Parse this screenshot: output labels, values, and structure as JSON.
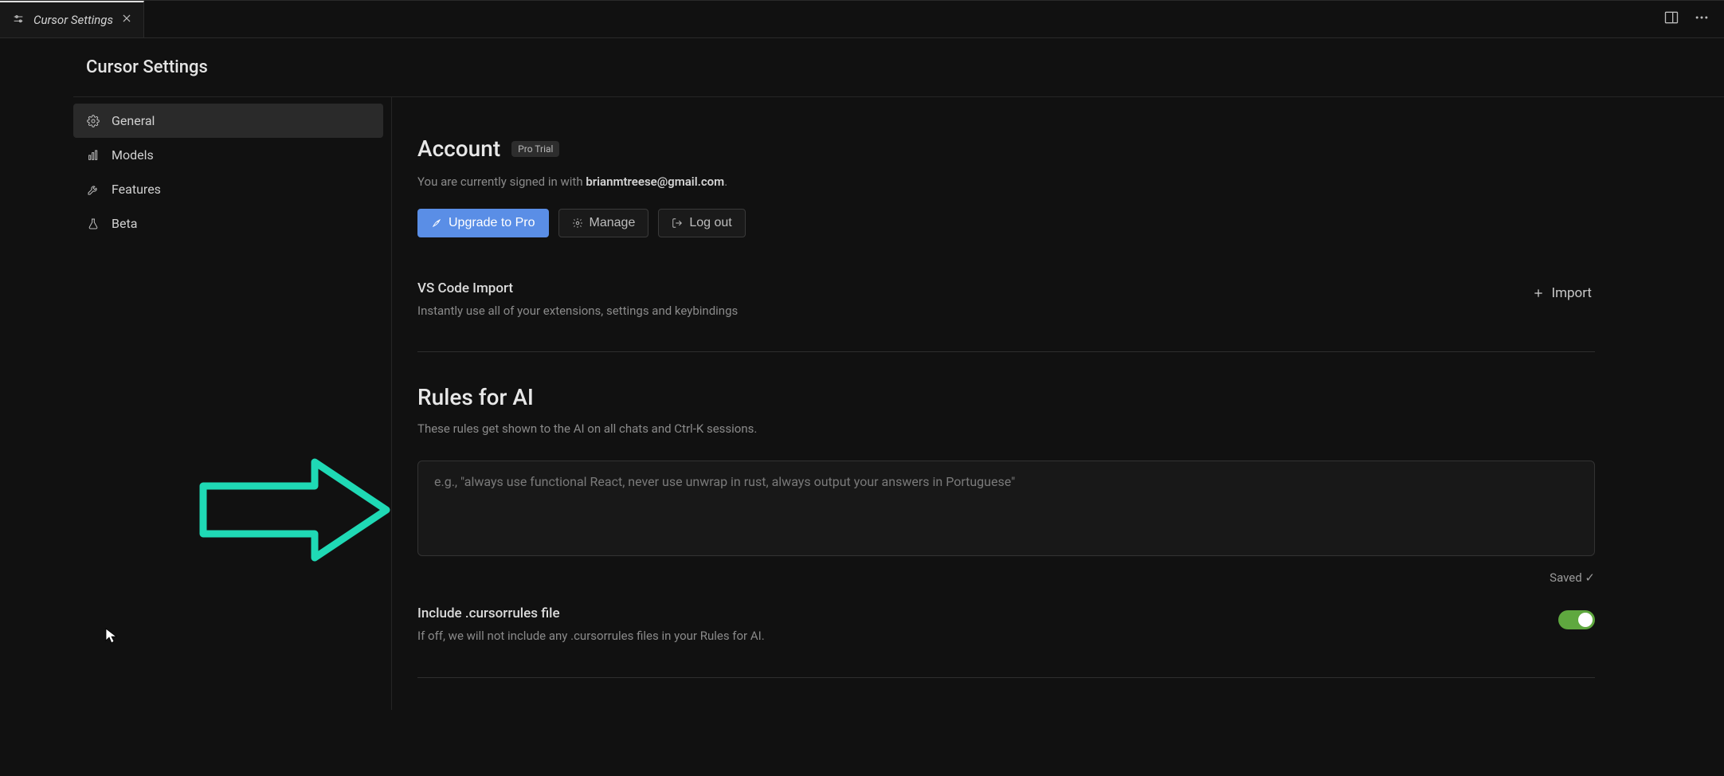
{
  "tab": {
    "title": "Cursor Settings"
  },
  "page_title": "Cursor Settings",
  "sidebar": {
    "items": [
      {
        "label": "General"
      },
      {
        "label": "Models"
      },
      {
        "label": "Features"
      },
      {
        "label": "Beta"
      }
    ]
  },
  "account": {
    "heading": "Account",
    "badge": "Pro Trial",
    "signed_in_prefix": "You are currently signed in with ",
    "email": "brianmtreese@gmail.com",
    "signed_in_suffix": ".",
    "upgrade_label": "Upgrade to Pro",
    "manage_label": "Manage",
    "logout_label": "Log out"
  },
  "vscode_import": {
    "title": "VS Code Import",
    "desc": "Instantly use all of your extensions, settings and keybindings",
    "button": "Import"
  },
  "rules": {
    "heading": "Rules for AI",
    "desc": "These rules get shown to the AI on all chats and Ctrl-K sessions.",
    "placeholder": "e.g., \"always use functional React, never use unwrap in rust, always output your answers in Portuguese\"",
    "value": "",
    "saved_label": "Saved ✓"
  },
  "cursorrules": {
    "title": "Include .cursorrules file",
    "desc": "If off, we will not include any .cursorrules files in your Rules for AI.",
    "enabled": true
  }
}
